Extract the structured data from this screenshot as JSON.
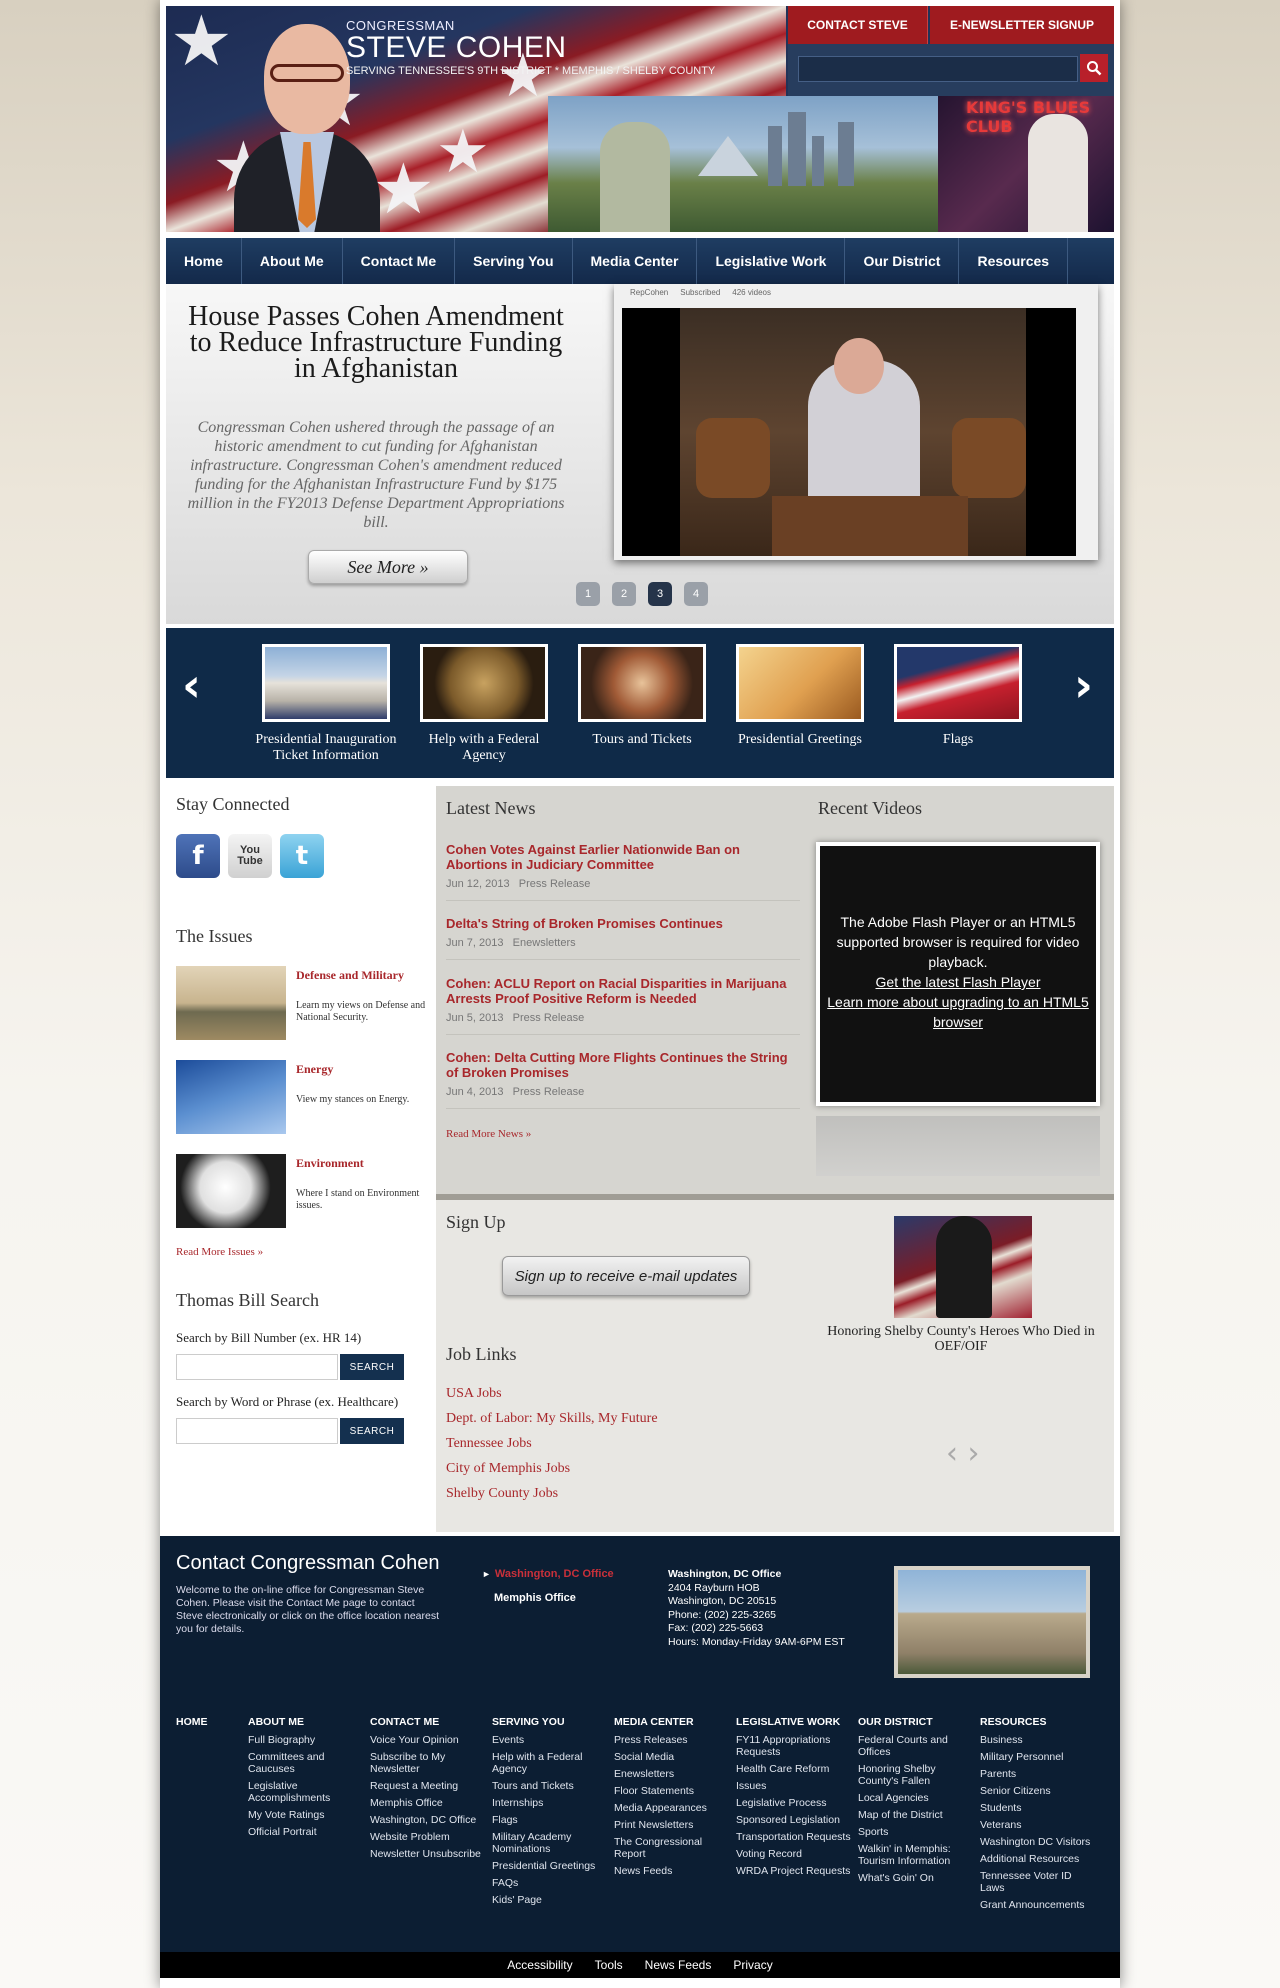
{
  "header": {
    "line1": "CONGRESSMAN",
    "line2": "STEVE COHEN",
    "line3": "SERVING TENNESSEE'S 9TH DISTRICT * MEMPHIS / SHELBY COUNTY",
    "contact_label": "CONTACT STEVE",
    "newsletter_label": "E-NEWSLETTER SIGNUP",
    "photo_text": "KING'S BLUES CLUB"
  },
  "nav": [
    "Home",
    "About Me",
    "Contact Me",
    "Serving You",
    "Media Center",
    "Legislative Work",
    "Our District",
    "Resources"
  ],
  "feature": {
    "title": "House Passes Cohen Amendment to Reduce Infrastructure Funding in Afghanistan",
    "description": "Congressman Cohen ushered through the passage of an historic amendment to cut funding for Afghanistan infrastructure. Congressman Cohen's amendment reduced funding for the Afghanistan Infrastructure Fund by $175 million in the FY2013 Defense Department Appropriations bill.",
    "button": "See More »",
    "video_bar": [
      "RepCohen",
      "Subscribed",
      "426 videos"
    ],
    "pages": [
      "1",
      "2",
      "3",
      "4"
    ],
    "active_page": "3"
  },
  "carousel": {
    "prev": "‹",
    "next": "›",
    "items": [
      {
        "label": "Presidential Inauguration Ticket Information"
      },
      {
        "label": "Help with a Federal Agency"
      },
      {
        "label": "Tours and Tickets"
      },
      {
        "label": "Presidential Greetings"
      },
      {
        "label": "Flags"
      }
    ]
  },
  "stay_connected": {
    "heading": "Stay Connected",
    "facebook": "f",
    "youtube": "You Tube",
    "twitter": "t"
  },
  "issues": {
    "heading": "The Issues",
    "items": [
      {
        "title": "Defense and Military",
        "desc": "Learn my views on Defense and National Security."
      },
      {
        "title": "Energy",
        "desc": "View my stances on Energy."
      },
      {
        "title": "Environment",
        "desc": "Where I stand on Environment issues."
      }
    ],
    "more": "Read More Issues »"
  },
  "bill_search": {
    "heading": "Thomas Bill Search",
    "label_number": "Search by Bill Number (ex. HR 14)",
    "label_word": "Search by Word or Phrase (ex. Healthcare)",
    "button": "SEARCH"
  },
  "latest_news": {
    "heading": "Latest News",
    "items": [
      {
        "title": "Cohen Votes Against Earlier Nationwide Ban on Abortions in Judiciary Committee",
        "date": "Jun 12, 2013",
        "type": "Press Release"
      },
      {
        "title": "Delta's String of Broken Promises Continues",
        "date": "Jun 7, 2013",
        "type": "Enewsletters"
      },
      {
        "title": "Cohen: ACLU Report on Racial Disparities in Marijuana Arrests Proof Positive Reform is Needed",
        "date": "Jun 5, 2013",
        "type": "Press Release"
      },
      {
        "title": "Cohen: Delta Cutting More Flights Continues the String of Broken Promises",
        "date": "Jun 4, 2013",
        "type": "Press Release"
      }
    ],
    "more": "Read More News »"
  },
  "recent_videos": {
    "heading": "Recent Videos",
    "flash_msg": "The Adobe Flash Player or an HTML5 supported browser is required for video playback.",
    "link1": "Get the latest Flash Player",
    "link2": "Learn more about upgrading to an HTML5 browser"
  },
  "signup": {
    "heading": "Sign Up",
    "button": "Sign up to receive e-mail updates"
  },
  "job_links": {
    "heading": "Job Links",
    "items": [
      "USA Jobs",
      "Dept. of Labor: My Skills, My Future",
      "Tennessee Jobs",
      "City of Memphis Jobs",
      "Shelby County Jobs"
    ]
  },
  "honor": {
    "caption": "Honoring Shelby County's Heroes Who Died in OEF/OIF",
    "nav": "‹ ›"
  },
  "footer": {
    "title": "Contact Congressman Cohen",
    "desc": "Welcome to the on-line office for Congressman Steve Cohen. Please visit the Contact Me page to contact Steve electronically or click on the office location nearest you for details.",
    "office_dc": "Washington, DC Office",
    "office_memphis": "Memphis Office",
    "addr": {
      "name": "Washington, DC Office",
      "line1": "2404 Rayburn HOB",
      "line2": "Washington, DC 20515",
      "phone": "Phone: (202) 225-3265",
      "fax": "Fax: (202) 225-5663",
      "hours": "Hours: Monday-Friday 9AM-6PM EST"
    },
    "columns": [
      {
        "h": "HOME",
        "items": []
      },
      {
        "h": "ABOUT ME",
        "items": [
          "Full Biography",
          "Committees and Caucuses",
          "Legislative Accomplishments",
          "My Vote Ratings",
          "Official Portrait"
        ]
      },
      {
        "h": "CONTACT ME",
        "items": [
          "Voice Your Opinion",
          "Subscribe to My Newsletter",
          "Request a Meeting",
          "Memphis Office",
          "Washington, DC Office",
          "Website Problem",
          "Newsletter Unsubscribe"
        ]
      },
      {
        "h": "SERVING YOU",
        "items": [
          "Events",
          "Help with a Federal Agency",
          "Tours and Tickets",
          "Internships",
          "Flags",
          "Military Academy Nominations",
          "Presidential Greetings",
          "FAQs",
          "Kids' Page"
        ]
      },
      {
        "h": "MEDIA CENTER",
        "items": [
          "Press Releases",
          "Social Media",
          "Enewsletters",
          "Floor Statements",
          "Media Appearances",
          "Print Newsletters",
          "The Congressional Report",
          "News Feeds"
        ]
      },
      {
        "h": "LEGISLATIVE WORK",
        "items": [
          "FY11 Appropriations Requests",
          "Health Care Reform",
          "Issues",
          "Legislative Process",
          "Sponsored Legislation",
          "Transportation Requests",
          "Voting Record",
          "WRDA Project Requests"
        ]
      },
      {
        "h": "OUR DISTRICT",
        "items": [
          "Federal Courts and Offices",
          "Honoring Shelby County's Fallen",
          "Local Agencies",
          "Map of the District",
          "Sports",
          "Walkin' in Memphis: Tourism Information",
          "What's Goin' On"
        ]
      },
      {
        "h": "RESOURCES",
        "items": [
          "Business",
          "Military Personnel",
          "Parents",
          "Senior Citizens",
          "Students",
          "Veterans",
          "Washington DC Visitors",
          "Additional Resources",
          "Tennessee Voter ID Laws",
          "Grant Announcements"
        ]
      }
    ]
  },
  "bottom_links": [
    "Accessibility",
    "Tools",
    "News Feeds",
    "Privacy"
  ],
  "colors": {
    "navy": "#14304f",
    "red": "#a8272b",
    "header_red": "#9f1b1f"
  }
}
